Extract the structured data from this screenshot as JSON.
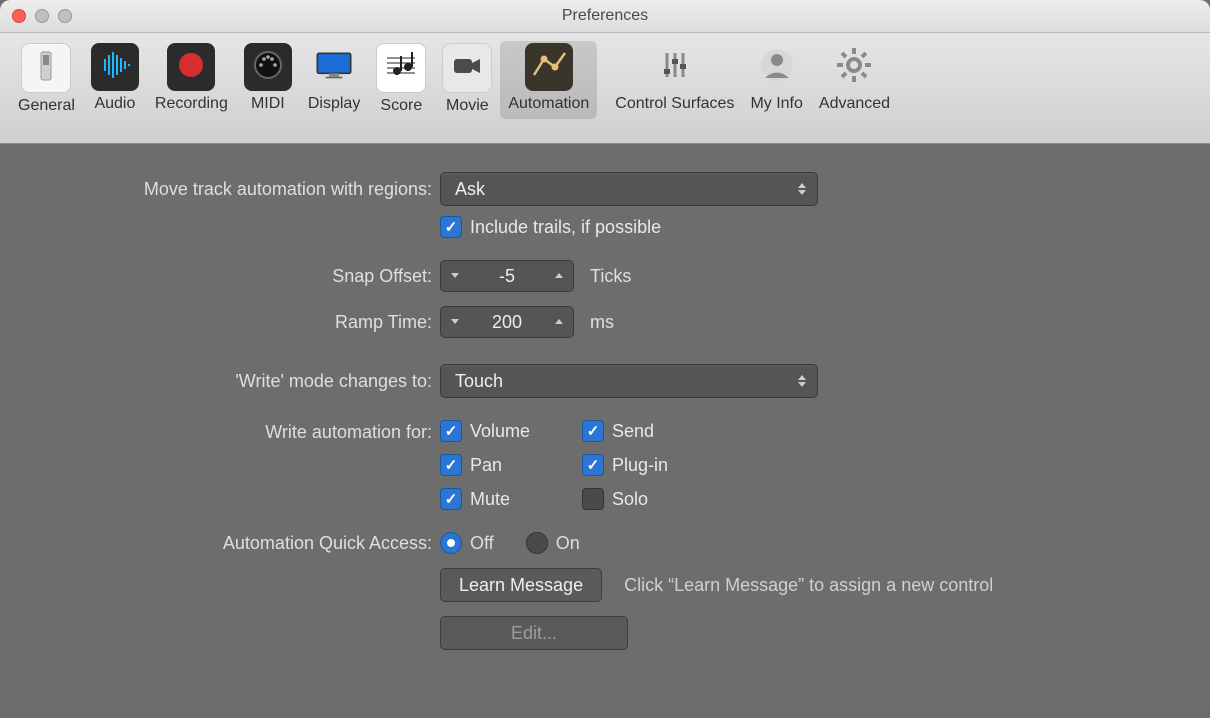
{
  "window": {
    "title": "Preferences"
  },
  "toolbar": {
    "tabs": [
      {
        "label": "General"
      },
      {
        "label": "Audio"
      },
      {
        "label": "Recording"
      },
      {
        "label": "MIDI"
      },
      {
        "label": "Display"
      },
      {
        "label": "Score"
      },
      {
        "label": "Movie"
      },
      {
        "label": "Automation"
      },
      {
        "label": "Control Surfaces"
      },
      {
        "label": "My Info"
      },
      {
        "label": "Advanced"
      }
    ],
    "active_index": 7
  },
  "form": {
    "move_automation": {
      "label": "Move track automation with regions:",
      "value": "Ask",
      "include_trails": {
        "label": "Include trails, if possible",
        "checked": true
      }
    },
    "snap_offset": {
      "label": "Snap Offset:",
      "value": "-5",
      "unit": "Ticks"
    },
    "ramp_time": {
      "label": "Ramp Time:",
      "value": "200",
      "unit": "ms"
    },
    "write_mode": {
      "label": "'Write' mode changes to:",
      "value": "Touch"
    },
    "write_for": {
      "label": "Write automation for:",
      "items": {
        "volume": {
          "label": "Volume",
          "checked": true
        },
        "send": {
          "label": "Send",
          "checked": true
        },
        "pan": {
          "label": "Pan",
          "checked": true
        },
        "plugin": {
          "label": "Plug-in",
          "checked": true
        },
        "mute": {
          "label": "Mute",
          "checked": true
        },
        "solo": {
          "label": "Solo",
          "checked": false
        }
      }
    },
    "quick_access": {
      "label": "Automation Quick Access:",
      "options": {
        "off": "Off",
        "on": "On"
      },
      "selected": "off",
      "learn_button": "Learn Message",
      "hint": "Click “Learn Message” to assign a new control",
      "edit_button": "Edit..."
    }
  }
}
